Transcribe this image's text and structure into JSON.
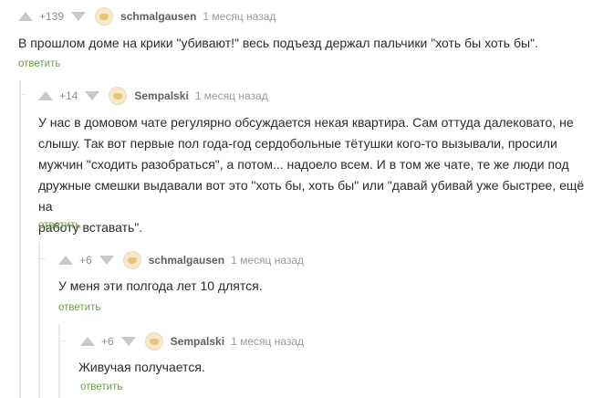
{
  "comments": [
    {
      "rating": "+139",
      "author": "schmalgausen",
      "time": "1 месяц назад",
      "text": "В прошлом доме на крики \"убивают!\" весь подъезд держал пальчики \"хоть бы хоть бы\".",
      "reply_label": "ответить"
    },
    {
      "rating": "+14",
      "author": "Sempalski",
      "time": "1 месяц назад",
      "text_lines": [
        "У нас в домовом чате регулярно обсуждается некая квартира. Сам оттуда далековато, не",
        "слышу. Так вот первые пол года-год сердобольные тётушки кого-то вызывали, просили",
        "мужчин \"сходить разобраться\", а потом... надоело всем. И в том же чате, те же люди под",
        "дружные смешки выдавали вот это \"хоть бы, хоть бы\" или \"давай убивай уже быстрее, ещё на",
        "работу вставать\"."
      ],
      "reply_label": "ответить"
    },
    {
      "rating": "+6",
      "author": "schmalgausen",
      "time": "1 месяц назад",
      "text": "У меня эти полгода лет 10 длятся.",
      "reply_label": "ответить"
    },
    {
      "rating": "+6",
      "author": "Sempalski",
      "time": "1 месяц назад",
      "text": "Живучая получается.",
      "reply_label": "ответить"
    }
  ]
}
